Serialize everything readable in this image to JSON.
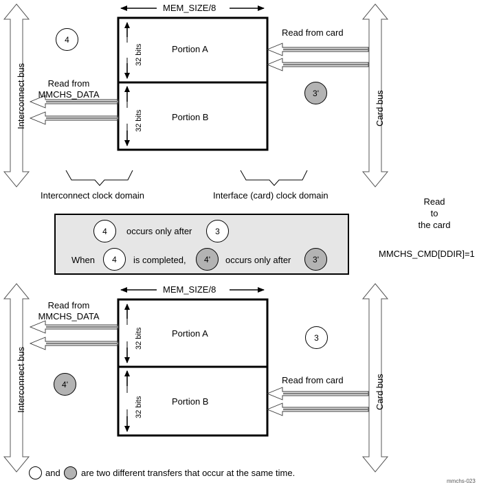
{
  "figure": {
    "id_label": "mmchs-023",
    "direction_note": [
      "Read",
      "to",
      "the card"
    ],
    "register_note": "MMCHS_CMD[DDIR]=1",
    "footer_note_and": "and",
    "footer_note_tail": "are two different transfers that occur at the same time."
  },
  "top_diagram": {
    "width_label": "MEM_SIZE/8",
    "left_bus_label": "Interconnect bus",
    "right_bus_label": "Card bus",
    "portion_a": "Portion A",
    "portion_b": "Portion B",
    "bits_a": "32 bits",
    "bits_b": "32 bits",
    "left_transfer_label_line1": "Read from",
    "left_transfer_label_line2": "MMCHS_DATA",
    "right_transfer_label": "Read from card",
    "left_marker": "4",
    "right_marker": "3'",
    "left_domain": "Interconnect clock domain",
    "right_domain": "Interface (card) clock domain"
  },
  "legend": {
    "row1_marker_a": "4",
    "row1_text": "occurs only after",
    "row1_marker_b": "3",
    "row2_prefix": "When",
    "row2_marker_a": "4",
    "row2_mid": "is completed,",
    "row2_marker_b": "4'",
    "row2_text": "occurs only after",
    "row2_marker_c": "3'"
  },
  "bottom_diagram": {
    "width_label": "MEM_SIZE/8",
    "left_bus_label": "Interconnect bus",
    "right_bus_label": "Card bus",
    "portion_a": "Portion A",
    "portion_b": "Portion B",
    "bits_a": "32 bits",
    "bits_b": "32 bits",
    "left_transfer_label_line1": "Read from",
    "left_transfer_label_line2": "MMCHS_DATA",
    "right_transfer_label": "Read from card",
    "left_marker": "4'",
    "right_marker": "3"
  },
  "colors": {
    "filled_marker": "#b3b3b3",
    "legend_background": "#e6e6e6",
    "stroke": "#000000",
    "arrow_stem": "#808080"
  }
}
